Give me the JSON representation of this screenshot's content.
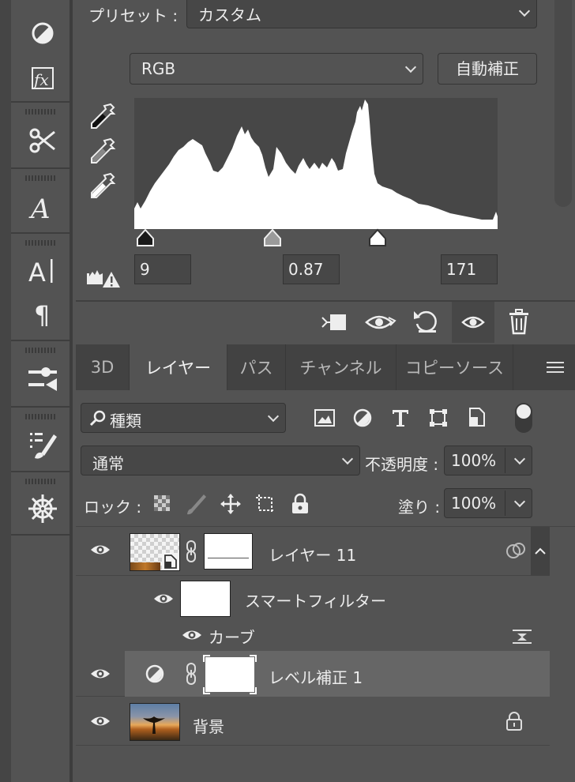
{
  "properties": {
    "preset_label": "プリセット :",
    "preset_value": "カスタム",
    "channel_value": "RGB",
    "auto_button": "自動補正",
    "input_black": "9",
    "input_gamma": "0.87",
    "input_white": "171"
  },
  "tabs": [
    "3D",
    "レイヤー",
    "パス",
    "チャンネル",
    "コピーソース"
  ],
  "active_tab": "レイヤー",
  "layers_panel": {
    "filter_value": "種類",
    "blend_mode": "通常",
    "opacity_label": "不透明度 :",
    "opacity_value": "100%",
    "lock_label": "ロック :",
    "fill_label": "塗り :",
    "fill_value": "100%"
  },
  "layers": [
    {
      "name": "レイヤー 11",
      "type": "smart-object"
    },
    {
      "name": "スマートフィルター",
      "type": "smart-filter"
    },
    {
      "name": "カーブ",
      "type": "filter"
    },
    {
      "name": "レベル補正 1",
      "type": "adjustment",
      "selected": true
    },
    {
      "name": "背景",
      "type": "background",
      "locked": true
    }
  ],
  "colors": {
    "panel_bg": "#535353",
    "dark_bg": "#424242",
    "histogram_bg": "#474747",
    "selected_row": "#666666",
    "text": "#e6e6e6"
  },
  "icons": [
    "adjust-icon",
    "fx-icon",
    "tools-icon",
    "glyph-icon",
    "character-icon",
    "paragraph-icon",
    "properties-icon",
    "brush-settings-icon",
    "wheel-icon"
  ]
}
